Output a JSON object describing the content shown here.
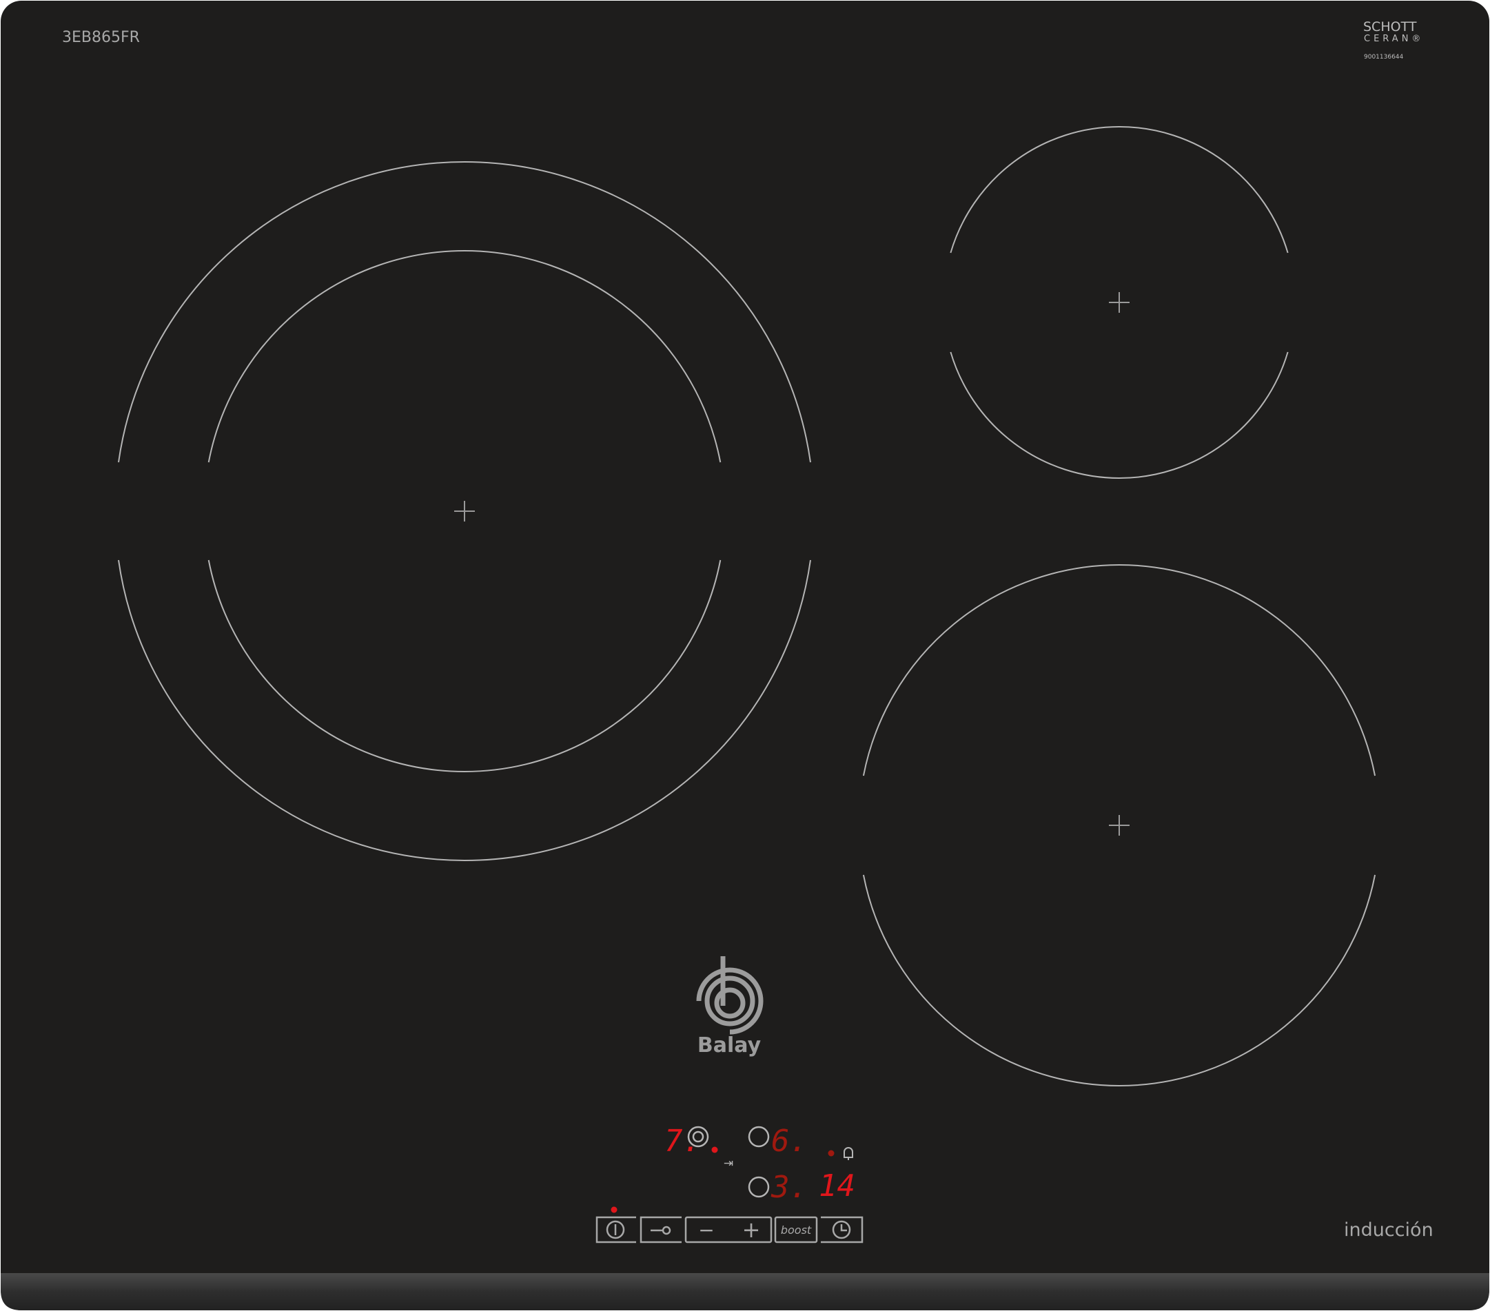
{
  "model_label": "3EB865FR",
  "brand_mark": {
    "line1": "SCHOTT",
    "line2": "CERAN®",
    "serial": "9001136644"
  },
  "logo": {
    "name": "Balay"
  },
  "type_label": "inducción",
  "displays": {
    "zone_front_left": "7.",
    "zone_rear_right": "6.",
    "zone_front_right": "3.",
    "timer": "14"
  },
  "controls": {
    "power_icon": "power-icon",
    "lock_icon": "key-lock-icon",
    "minus": "−",
    "plus": "+",
    "boost_label": "boost",
    "timer_icon": "clock-icon",
    "transfer_icon": "⇥",
    "bell_icon": "bell-icon"
  },
  "colors": {
    "glass": "#1e1d1c",
    "lines": "#b8b8b8",
    "led_bright": "#e0161b",
    "led_dim": "#a0190f"
  }
}
